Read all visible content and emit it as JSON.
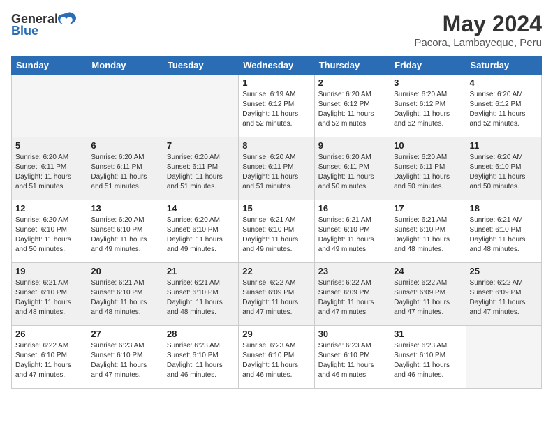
{
  "logo": {
    "general": "General",
    "blue": "Blue"
  },
  "header": {
    "month_year": "May 2024",
    "location": "Pacora, Lambayeque, Peru"
  },
  "days_of_week": [
    "Sunday",
    "Monday",
    "Tuesday",
    "Wednesday",
    "Thursday",
    "Friday",
    "Saturday"
  ],
  "weeks": [
    [
      {
        "day": "",
        "sunrise": "",
        "sunset": "",
        "daylight": "",
        "empty": true
      },
      {
        "day": "",
        "sunrise": "",
        "sunset": "",
        "daylight": "",
        "empty": true
      },
      {
        "day": "",
        "sunrise": "",
        "sunset": "",
        "daylight": "",
        "empty": true
      },
      {
        "day": "1",
        "sunrise": "Sunrise: 6:19 AM",
        "sunset": "Sunset: 6:12 PM",
        "daylight": "Daylight: 11 hours and 52 minutes."
      },
      {
        "day": "2",
        "sunrise": "Sunrise: 6:20 AM",
        "sunset": "Sunset: 6:12 PM",
        "daylight": "Daylight: 11 hours and 52 minutes."
      },
      {
        "day": "3",
        "sunrise": "Sunrise: 6:20 AM",
        "sunset": "Sunset: 6:12 PM",
        "daylight": "Daylight: 11 hours and 52 minutes."
      },
      {
        "day": "4",
        "sunrise": "Sunrise: 6:20 AM",
        "sunset": "Sunset: 6:12 PM",
        "daylight": "Daylight: 11 hours and 52 minutes."
      }
    ],
    [
      {
        "day": "5",
        "sunrise": "Sunrise: 6:20 AM",
        "sunset": "Sunset: 6:11 PM",
        "daylight": "Daylight: 11 hours and 51 minutes."
      },
      {
        "day": "6",
        "sunrise": "Sunrise: 6:20 AM",
        "sunset": "Sunset: 6:11 PM",
        "daylight": "Daylight: 11 hours and 51 minutes."
      },
      {
        "day": "7",
        "sunrise": "Sunrise: 6:20 AM",
        "sunset": "Sunset: 6:11 PM",
        "daylight": "Daylight: 11 hours and 51 minutes."
      },
      {
        "day": "8",
        "sunrise": "Sunrise: 6:20 AM",
        "sunset": "Sunset: 6:11 PM",
        "daylight": "Daylight: 11 hours and 51 minutes."
      },
      {
        "day": "9",
        "sunrise": "Sunrise: 6:20 AM",
        "sunset": "Sunset: 6:11 PM",
        "daylight": "Daylight: 11 hours and 50 minutes."
      },
      {
        "day": "10",
        "sunrise": "Sunrise: 6:20 AM",
        "sunset": "Sunset: 6:11 PM",
        "daylight": "Daylight: 11 hours and 50 minutes."
      },
      {
        "day": "11",
        "sunrise": "Sunrise: 6:20 AM",
        "sunset": "Sunset: 6:10 PM",
        "daylight": "Daylight: 11 hours and 50 minutes."
      }
    ],
    [
      {
        "day": "12",
        "sunrise": "Sunrise: 6:20 AM",
        "sunset": "Sunset: 6:10 PM",
        "daylight": "Daylight: 11 hours and 50 minutes."
      },
      {
        "day": "13",
        "sunrise": "Sunrise: 6:20 AM",
        "sunset": "Sunset: 6:10 PM",
        "daylight": "Daylight: 11 hours and 49 minutes."
      },
      {
        "day": "14",
        "sunrise": "Sunrise: 6:20 AM",
        "sunset": "Sunset: 6:10 PM",
        "daylight": "Daylight: 11 hours and 49 minutes."
      },
      {
        "day": "15",
        "sunrise": "Sunrise: 6:21 AM",
        "sunset": "Sunset: 6:10 PM",
        "daylight": "Daylight: 11 hours and 49 minutes."
      },
      {
        "day": "16",
        "sunrise": "Sunrise: 6:21 AM",
        "sunset": "Sunset: 6:10 PM",
        "daylight": "Daylight: 11 hours and 49 minutes."
      },
      {
        "day": "17",
        "sunrise": "Sunrise: 6:21 AM",
        "sunset": "Sunset: 6:10 PM",
        "daylight": "Daylight: 11 hours and 48 minutes."
      },
      {
        "day": "18",
        "sunrise": "Sunrise: 6:21 AM",
        "sunset": "Sunset: 6:10 PM",
        "daylight": "Daylight: 11 hours and 48 minutes."
      }
    ],
    [
      {
        "day": "19",
        "sunrise": "Sunrise: 6:21 AM",
        "sunset": "Sunset: 6:10 PM",
        "daylight": "Daylight: 11 hours and 48 minutes."
      },
      {
        "day": "20",
        "sunrise": "Sunrise: 6:21 AM",
        "sunset": "Sunset: 6:10 PM",
        "daylight": "Daylight: 11 hours and 48 minutes."
      },
      {
        "day": "21",
        "sunrise": "Sunrise: 6:21 AM",
        "sunset": "Sunset: 6:10 PM",
        "daylight": "Daylight: 11 hours and 48 minutes."
      },
      {
        "day": "22",
        "sunrise": "Sunrise: 6:22 AM",
        "sunset": "Sunset: 6:09 PM",
        "daylight": "Daylight: 11 hours and 47 minutes."
      },
      {
        "day": "23",
        "sunrise": "Sunrise: 6:22 AM",
        "sunset": "Sunset: 6:09 PM",
        "daylight": "Daylight: 11 hours and 47 minutes."
      },
      {
        "day": "24",
        "sunrise": "Sunrise: 6:22 AM",
        "sunset": "Sunset: 6:09 PM",
        "daylight": "Daylight: 11 hours and 47 minutes."
      },
      {
        "day": "25",
        "sunrise": "Sunrise: 6:22 AM",
        "sunset": "Sunset: 6:09 PM",
        "daylight": "Daylight: 11 hours and 47 minutes."
      }
    ],
    [
      {
        "day": "26",
        "sunrise": "Sunrise: 6:22 AM",
        "sunset": "Sunset: 6:10 PM",
        "daylight": "Daylight: 11 hours and 47 minutes."
      },
      {
        "day": "27",
        "sunrise": "Sunrise: 6:23 AM",
        "sunset": "Sunset: 6:10 PM",
        "daylight": "Daylight: 11 hours and 47 minutes."
      },
      {
        "day": "28",
        "sunrise": "Sunrise: 6:23 AM",
        "sunset": "Sunset: 6:10 PM",
        "daylight": "Daylight: 11 hours and 46 minutes."
      },
      {
        "day": "29",
        "sunrise": "Sunrise: 6:23 AM",
        "sunset": "Sunset: 6:10 PM",
        "daylight": "Daylight: 11 hours and 46 minutes."
      },
      {
        "day": "30",
        "sunrise": "Sunrise: 6:23 AM",
        "sunset": "Sunset: 6:10 PM",
        "daylight": "Daylight: 11 hours and 46 minutes."
      },
      {
        "day": "31",
        "sunrise": "Sunrise: 6:23 AM",
        "sunset": "Sunset: 6:10 PM",
        "daylight": "Daylight: 11 hours and 46 minutes."
      },
      {
        "day": "",
        "sunrise": "",
        "sunset": "",
        "daylight": "",
        "empty": true
      }
    ]
  ]
}
